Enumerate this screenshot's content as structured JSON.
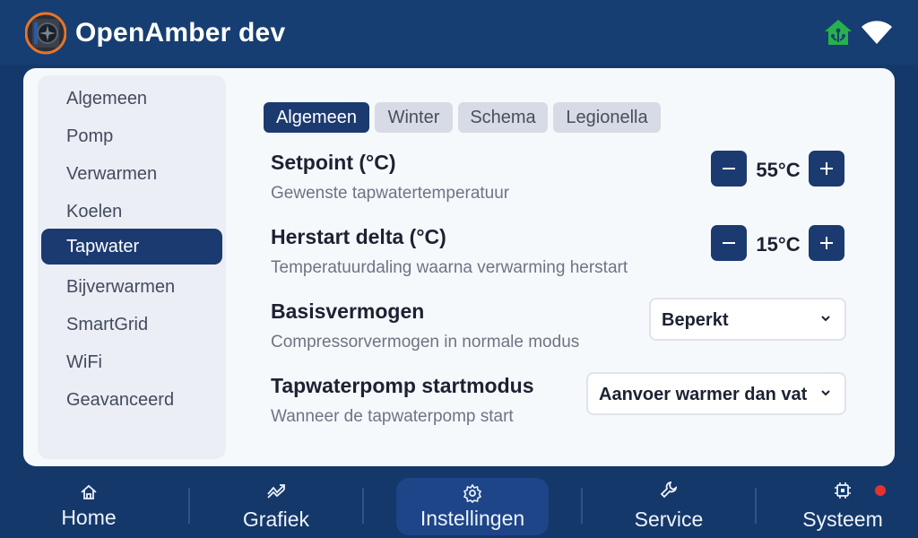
{
  "header": {
    "title": "OpenAmber dev",
    "icons": [
      "heat-pump-logo",
      "home-automation-icon",
      "wifi-icon"
    ]
  },
  "sidebar": {
    "items": [
      {
        "label": "Algemeen"
      },
      {
        "label": "Pomp"
      },
      {
        "label": "Verwarmen"
      },
      {
        "label": "Koelen"
      },
      {
        "label": "Tapwater",
        "active": true
      },
      {
        "label": "Bijverwarmen"
      },
      {
        "label": "SmartGrid"
      },
      {
        "label": "WiFi"
      },
      {
        "label": "Geavanceerd"
      }
    ]
  },
  "tabs": [
    {
      "label": "Algemeen",
      "active": true
    },
    {
      "label": "Winter"
    },
    {
      "label": "Schema"
    },
    {
      "label": "Legionella"
    }
  ],
  "settings": {
    "setpoint": {
      "title": "Setpoint (°C)",
      "desc": "Gewenste tapwatertemperatuur",
      "value": "55°C"
    },
    "restart_delta": {
      "title": "Herstart delta (°C)",
      "desc": "Temperatuurdaling waarna verwarming herstart",
      "value": "15°C"
    },
    "base_power": {
      "title": "Basisvermogen",
      "desc": "Compressorvermogen in normale modus",
      "selected": "Beperkt"
    },
    "pump_start": {
      "title": "Tapwaterpomp startmodus",
      "desc": "Wanneer de tapwaterpomp start",
      "selected": "Aanvoer warmer dan vat"
    }
  },
  "nav": {
    "items": [
      {
        "label": "Home",
        "icon": "home-icon"
      },
      {
        "label": "Grafiek",
        "icon": "chart-icon"
      },
      {
        "label": "Instellingen",
        "icon": "gear-icon",
        "active": true
      },
      {
        "label": "Service",
        "icon": "wrench-icon"
      },
      {
        "label": "Systeem",
        "icon": "chip-icon"
      }
    ]
  },
  "colors": {
    "header_bg": "#173e72",
    "accent": "#1b3a70",
    "nav_active": "#1d4587",
    "status_green": "#27b14a",
    "alert_red": "#e5322f"
  }
}
